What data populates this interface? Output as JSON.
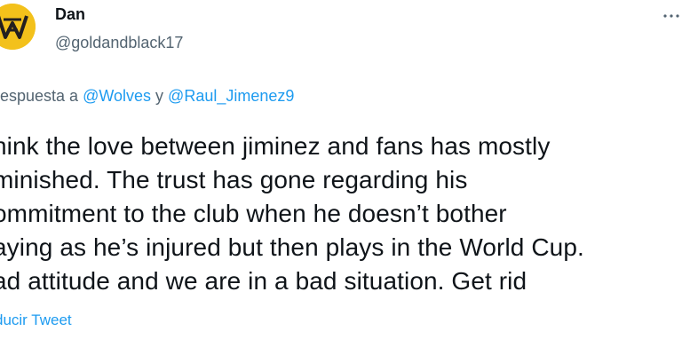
{
  "author": {
    "name": "Dan",
    "handle": "@goldandblack17",
    "avatar_icon": "wolves-crest-icon",
    "avatar_color": "#f3c11b"
  },
  "menu": {
    "icon": "more-horizontal-icon"
  },
  "reply": {
    "prefix": "respuesta a ",
    "mention_1": "@Wolves",
    "joiner": " y ",
    "mention_2": "@Raul_Jimenez9"
  },
  "tweet": {
    "lines": [
      "hink the love between jiminez and fans has mostly",
      "minished. The trust has gone regarding his",
      "ommitment to the club when he doesn’t bother",
      "aying as he’s injured but then plays in the World Cup.",
      "ad attitude and we are in a bad situation. Get rid"
    ]
  },
  "translate": {
    "label": "ducir Tweet"
  },
  "colors": {
    "text": "#0f1419",
    "secondary": "#536471",
    "link": "#1d9bf0"
  }
}
